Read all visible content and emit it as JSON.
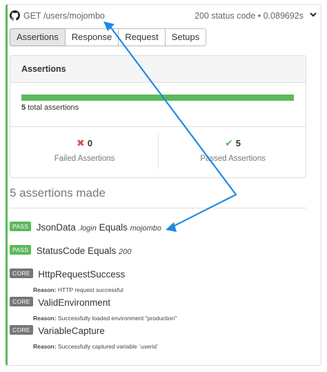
{
  "header": {
    "request": "GET /users/mojombo",
    "status": "200 status code • 0.089692s"
  },
  "tabs": [
    "Assertions",
    "Response",
    "Request",
    "Setups"
  ],
  "assertions_panel": {
    "title": "Assertions",
    "progress_passed_fraction": 1.0,
    "total_count": "5",
    "total_label": "total assertions",
    "failed": {
      "count": "0",
      "label": "Failed Assertions"
    },
    "passed": {
      "count": "5",
      "label": "Passed Assertions"
    }
  },
  "made_heading": "5 assertions made",
  "items": [
    {
      "badge": "PASS",
      "pre": "JsonData",
      "field": ".login",
      "op": "Equals",
      "value": "mojombo"
    },
    {
      "badge": "PASS",
      "pre": "StatusCode Equals",
      "value": "200"
    },
    {
      "badge": "CORE",
      "name": "HttpRequestSuccess",
      "reason_label": "Reason:",
      "reason": "HTTP request successful"
    },
    {
      "badge": "CORE",
      "name": "ValidEnvironment",
      "reason_label": "Reason:",
      "reason": "Successfully loaded environment \"production\""
    },
    {
      "badge": "CORE",
      "name": "VariableCapture",
      "reason_label": "Reason:",
      "reason": "Successfully captured variable `userid`"
    }
  ],
  "colors": {
    "pass": "#5cb85c",
    "core": "#777777",
    "annotation_arrow": "#1e88e5"
  },
  "icons": [
    "github-icon",
    "chevron-down-icon",
    "x-icon",
    "check-icon"
  ]
}
